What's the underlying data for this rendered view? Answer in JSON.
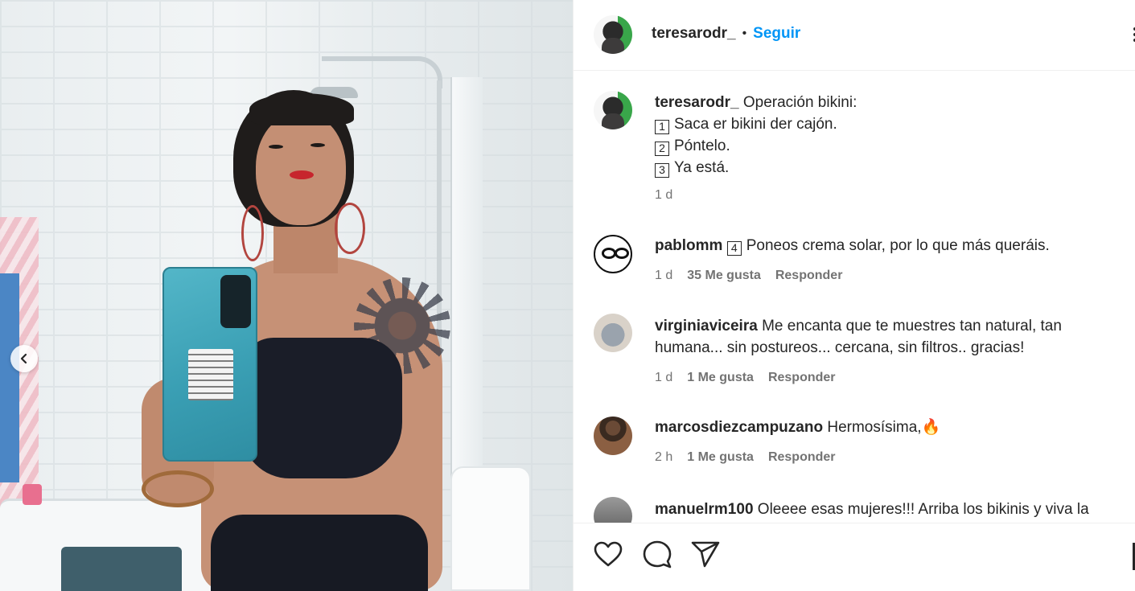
{
  "post": {
    "author": "teresarodr_",
    "separator": "•",
    "follow_label": "Seguir",
    "caption_title": "Operación bikini:",
    "caption_lines": [
      {
        "num": "1",
        "text": "Saca er bikini der cajón."
      },
      {
        "num": "2",
        "text": "Póntelo."
      },
      {
        "num": "3",
        "text": "Ya está."
      }
    ],
    "caption_time": "1 d"
  },
  "comments": [
    {
      "user": "pablomm",
      "num": "4",
      "text": "Poneos crema solar, por lo que más queráis.",
      "time": "1 d",
      "likes": "35 Me gusta",
      "reply": "Responder"
    },
    {
      "user": "virginiaviceira",
      "text": "Me encanta que te muestres tan natural, tan",
      "text2": "humana... sin postureos... cercana, sin filtros.. gracias!",
      "time": "1 d",
      "likes": "1 Me gusta",
      "reply": "Responder"
    },
    {
      "user": "marcosdiezcampuzano",
      "text": "Hermosísima,🔥",
      "time": "2 h",
      "likes": "1 Me gusta",
      "reply": "Responder"
    },
    {
      "user": "manuelrm100",
      "text": "Oleeee esas mujeres!!! Arriba los bikinis y viva la"
    }
  ],
  "icons": {
    "like": "heart-icon",
    "comment": "comment-bubble-icon",
    "share": "paper-plane-icon",
    "prev": "chevron-left-icon",
    "more": "more-options-icon",
    "save": "bookmark-icon"
  },
  "colors": {
    "accent": "#0095f6",
    "text": "#262626",
    "muted": "#737373",
    "divider": "#efefef"
  }
}
